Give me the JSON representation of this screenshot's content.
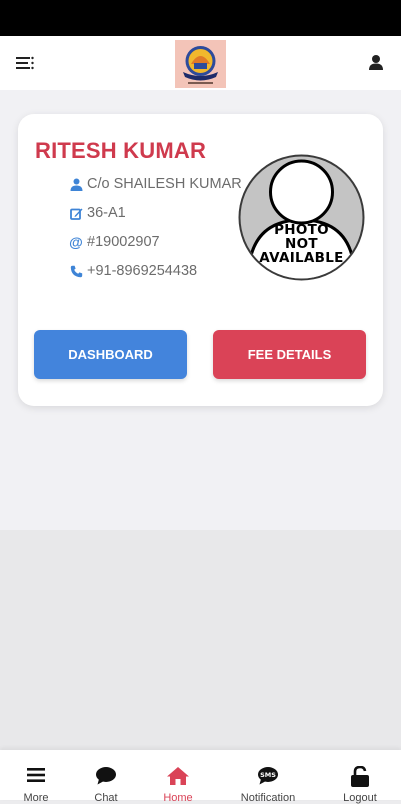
{
  "student": {
    "name": "RITESH KUMAR",
    "guardian": "C/o SHAILESH KUMAR",
    "class_section": "36-A1",
    "roll_no": "#19002907",
    "phone": "+91-8969254438",
    "photo_text": [
      "PHOTO",
      "NOT",
      "AVAILABLE"
    ]
  },
  "actions": {
    "dashboard_label": "DASHBOARD",
    "fee_label": "FEE DETAILS"
  },
  "nav": {
    "more": "More",
    "chat": "Chat",
    "home": "Home",
    "notification": "Notification",
    "logout": "Logout"
  },
  "colors": {
    "accent_red": "#da4357",
    "accent_blue": "#4384dc",
    "name_color": "#cf3a4d"
  },
  "icons": [
    "menu-icon",
    "school-logo",
    "user-icon",
    "person-icon",
    "edit-icon",
    "at-icon",
    "phone-icon",
    "chat-icon",
    "home-icon",
    "sms-icon",
    "unlock-icon"
  ]
}
